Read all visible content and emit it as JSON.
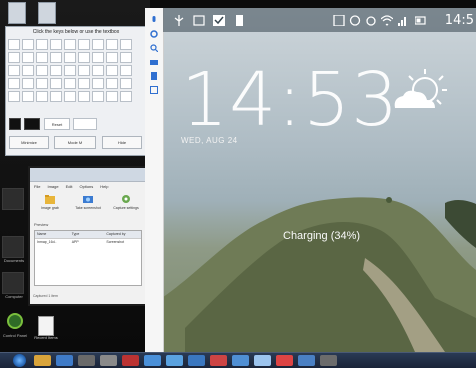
{
  "osk": {
    "title": "Click the keys below or use the textbox",
    "rows": [
      [
        "",
        "",
        "",
        "",
        "",
        "",
        "",
        "",
        ""
      ],
      [
        "",
        "",
        "",
        "",
        "",
        "",
        "",
        "",
        ""
      ],
      [
        "",
        "",
        "",
        "",
        "",
        "",
        "",
        "",
        ""
      ],
      [
        "",
        "",
        "",
        "",
        "",
        "",
        "",
        "",
        ""
      ],
      [
        "",
        "",
        "",
        "",
        "",
        "",
        "",
        "",
        ""
      ]
    ],
    "button_left": "Reset",
    "button_mid": "Backspace",
    "button_right": "Delete",
    "bottom_left": "Minimize",
    "bottom_mid": "Mode M",
    "bottom_right": "Hide"
  },
  "explorer": {
    "menu": [
      "File",
      "Image",
      "Edit",
      "Options",
      "Help"
    ],
    "ribbon": [
      {
        "label": "Image grab",
        "icon": "folder-icon"
      },
      {
        "label": "Take screenshot",
        "icon": "camera-icon"
      },
      {
        "label": "Capture settings",
        "icon": "settings-icon"
      }
    ],
    "section": "Preview",
    "columns": [
      "Name",
      "Type",
      "Captured by"
    ],
    "rows": [
      [
        "Inmap_16d..",
        "APP",
        "Screenshot"
      ]
    ],
    "status": "Captured 1 item"
  },
  "desktop": {
    "side_icons": [
      "",
      "",
      "",
      "Documents",
      "Computer"
    ],
    "file_label": "Recent Items",
    "control_panel_label": "Control Panel"
  },
  "phone": {
    "status_time": "14:5",
    "clock": "14:53",
    "date": "WED, AUG 24",
    "charging": "Charging (34%)"
  },
  "colors": {
    "accent_blue": "#2f6fd0",
    "status_bar": "#37464f",
    "taskbar": "#1a2438"
  }
}
